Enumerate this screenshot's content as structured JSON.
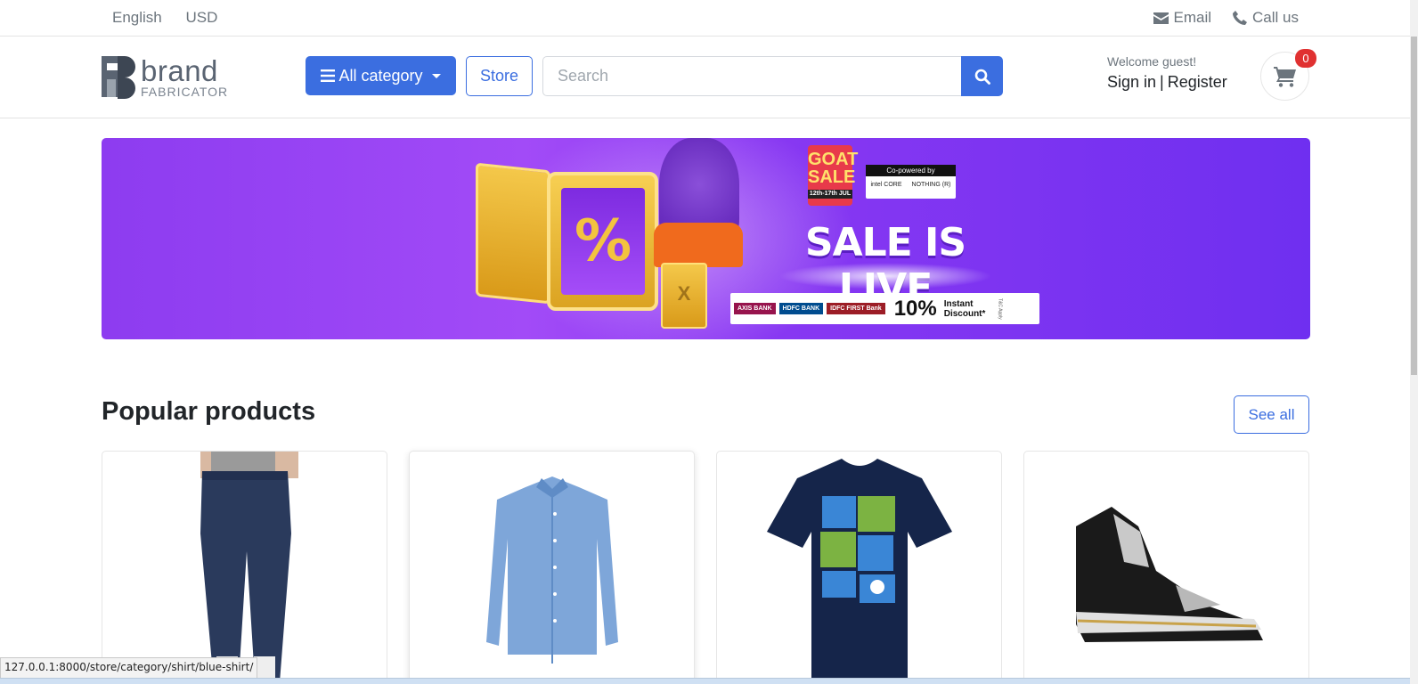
{
  "topbar": {
    "language": "English",
    "currency": "USD",
    "email_label": "Email",
    "call_label": "Call us"
  },
  "header": {
    "logo_word": "brand",
    "logo_sub": "FABRICATOR",
    "category_button": "All category",
    "store_button": "Store",
    "search_placeholder": "Search",
    "welcome": "Welcome guest!",
    "sign_in": "Sign in",
    "register": "Register",
    "cart_count": "0"
  },
  "banner": {
    "goat_sale": "GOAT SALE",
    "goat_dates": "12th-17th JUL",
    "copowered": "Co-powered by",
    "partner1": "intel CORE",
    "partner2": "NOTHING (R)",
    "headline": "SALE IS LIVE",
    "safe_symbol": "%",
    "box_symbol": "X",
    "banks": [
      "AXIS BANK",
      "HDFC BANK",
      "IDFC FIRST Bank"
    ],
    "discount_value": "10%",
    "discount_text": "Instant Discount*",
    "tnc": "T&C Apply"
  },
  "popular": {
    "title": "Popular products",
    "see_all": "See all",
    "products": [
      {
        "name": "jeans"
      },
      {
        "name": "blue-shirt"
      },
      {
        "name": "graphic-tshirt"
      },
      {
        "name": "sneaker"
      }
    ]
  },
  "status_url": "127.0.0.1:8000/store/category/shirt/blue-shirt/",
  "colors": {
    "primary": "#3b6ee0",
    "badge": "#e03131",
    "banner": "#8d3cf0"
  }
}
